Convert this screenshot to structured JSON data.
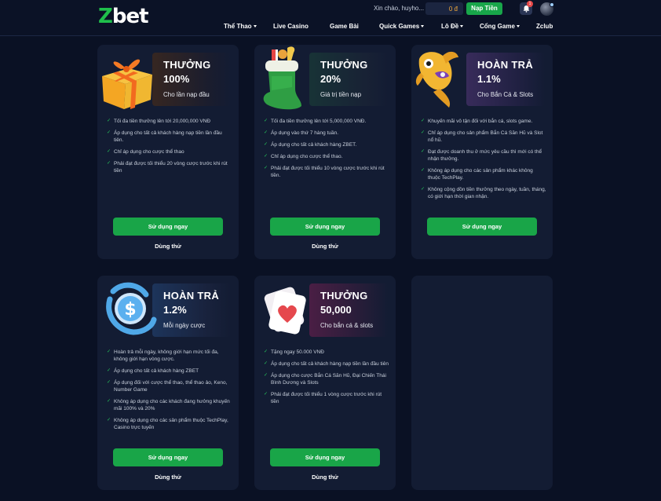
{
  "header": {
    "logo_z": "Z",
    "logo_rest": "bet",
    "greeting": "Xin chào, huyho...",
    "balance": "0 đ",
    "deposit_label": "Nạp Tiền",
    "notification_count": "1",
    "nav": [
      {
        "label": "Thể Thao",
        "dropdown": true
      },
      {
        "label": "Live Casino",
        "dropdown": false
      },
      {
        "label": "Game Bài",
        "dropdown": false
      },
      {
        "label": "Quick Games",
        "dropdown": true
      },
      {
        "label": "Lô Đề",
        "dropdown": true
      },
      {
        "label": "Cổng Game",
        "dropdown": true
      },
      {
        "label": "Zclub",
        "dropdown": false
      }
    ]
  },
  "colors": {
    "background": "#0a1124",
    "card": "#131c33",
    "accent_green": "#19a548",
    "balance_orange": "#f2a93b"
  },
  "promotions": [
    {
      "icon": "gift-box-icon",
      "title": "THƯỞNG",
      "value": "100%",
      "subtitle": "Cho lần nạp đầu",
      "bullets": [
        "Tối đa tiền thưởng lên tới 20,000,000 VNĐ",
        "Áp dụng cho tất cả khách hàng nạp tiền lần đầu tiên.",
        "Chỉ áp dụng cho cược thể thao",
        "Phải đạt được tối thiểu 20 vòng cược trước khi rút tiền"
      ],
      "use_label": "Sử dụng ngay",
      "try_label": "Dùng thử"
    },
    {
      "icon": "stocking-icon",
      "title": "THƯỞNG",
      "value": "20%",
      "subtitle": "Giá trị tiền nạp",
      "bullets": [
        "Tối đa tiền thưởng lên tới 5,000,000 VNĐ.",
        "Áp dụng vào thứ 7 hàng tuần.",
        "Áp dụng cho tất cả khách hàng ZBET.",
        "Chỉ áp dụng cho cược thể thao.",
        "Phải đạt được tối thiểu 10 vòng cược trước khi rút tiền."
      ],
      "use_label": "Sử dụng ngay",
      "try_label": "Dùng thử"
    },
    {
      "icon": "golden-fish-icon",
      "title": "HOÀN TRẢ",
      "value": "1.1%",
      "subtitle": "Cho Bắn Cá & Slots",
      "bullets": [
        "Khuyến mãi vô tận đối với bắn cá, slots game.",
        "Chỉ áp dụng cho sản phẩm Bắn Cá Săn Hũ và Slot nổ hũ.",
        "Đạt được doanh thu ở mức yêu cầu thì mới có thể nhận thưởng.",
        "Không áp dụng cho các sản phẩm khác không thuộc TechPlay.",
        "Không cộng dồn tiền thưởng theo ngày, tuần, tháng, có giới hạn thời gian nhận."
      ],
      "use_label": "Sử dụng ngay"
    },
    {
      "icon": "dollar-coin-icon",
      "title": "HOÀN TRẢ",
      "value": "1.2%",
      "subtitle": "Mỗi ngày cược",
      "bullets": [
        "Hoàn trả mỗi ngày, không giới hạn mức tối đa, không giới hạn vòng cược.",
        "Áp dụng cho tất cả khách hàng ZBET",
        "Áp dụng đối với cược thể thao, thể thao ảo, Keno, Number Game",
        "Không áp dụng cho các khách đang hưởng khuyến mãi 100% và 20%",
        "Không áp dụng cho các sản phẩm thuộc TechPlay, Casino trực tuyến"
      ],
      "use_label": "Sử dụng ngay",
      "try_label": "Dùng thử"
    },
    {
      "icon": "heart-card-icon",
      "title": "THƯỞNG",
      "value": "50,000",
      "subtitle": "Cho bắn cá & slots",
      "bullets": [
        "Tặng ngay 50.000 VNĐ",
        "Áp dụng cho tất cả khách hàng nạp tiền lần đầu tiên",
        "Áp dụng cho cược Bắn Cá Săn Hũ, Đại Chiến Thái Bình Dương và Slots",
        "Phải đạt được tối thiểu 1 vòng cược trước khi rút tiền"
      ],
      "use_label": "Sử dụng ngay",
      "try_label": "Dùng thử"
    }
  ]
}
